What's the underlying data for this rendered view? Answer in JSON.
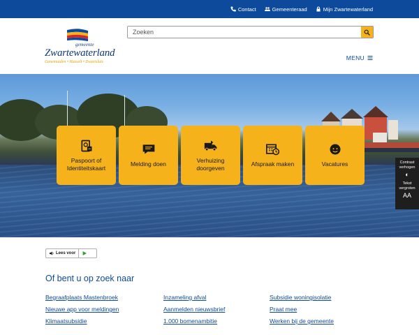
{
  "topbar": {
    "links": [
      {
        "label": "Contact",
        "icon": "phone-icon"
      },
      {
        "label": "Gemeenteraad",
        "icon": "people-icon"
      },
      {
        "label": "Mijn Zwartewaterland",
        "icon": "lock-icon"
      }
    ]
  },
  "logo": {
    "small": "gemeente",
    "name": "Zwartewaterland",
    "places": "Genemuiden • Hasselt • Zwartsluis"
  },
  "search": {
    "placeholder": "Zoeken",
    "value": ""
  },
  "menu": {
    "label": "MENU"
  },
  "tiles": [
    {
      "label": "Paspoort of Identiteitskaart",
      "icon": "passport-icon"
    },
    {
      "label": "Melding doen",
      "icon": "speech-bubble-icon"
    },
    {
      "label": "Verhuizing doorgeven",
      "icon": "moving-truck-icon"
    },
    {
      "label": "Afspraak maken",
      "icon": "calendar-clock-icon"
    },
    {
      "label": "Vacatures",
      "icon": "smiley-icon"
    }
  ],
  "accessibility": {
    "contrast": "Contrast verhogen",
    "text": "Tekst vergroten",
    "text_icon": "AA"
  },
  "readaloud": {
    "label": "Lees voor"
  },
  "section": {
    "title": "Of bent u op zoek naar",
    "links": [
      "Begraafplaats Mastenbroek",
      "Inzameling afval",
      "Subsidie woningisolatie",
      "Nieuwe app voor meldingen",
      "Aanmelden nieuwsbrief",
      "Praat mee",
      "Klimaatsubsidie",
      "1.000 bomenambitie",
      "Werken bij de gemeente"
    ]
  },
  "colors": {
    "primary": "#0d4a9c",
    "accent": "#f5b21b"
  }
}
